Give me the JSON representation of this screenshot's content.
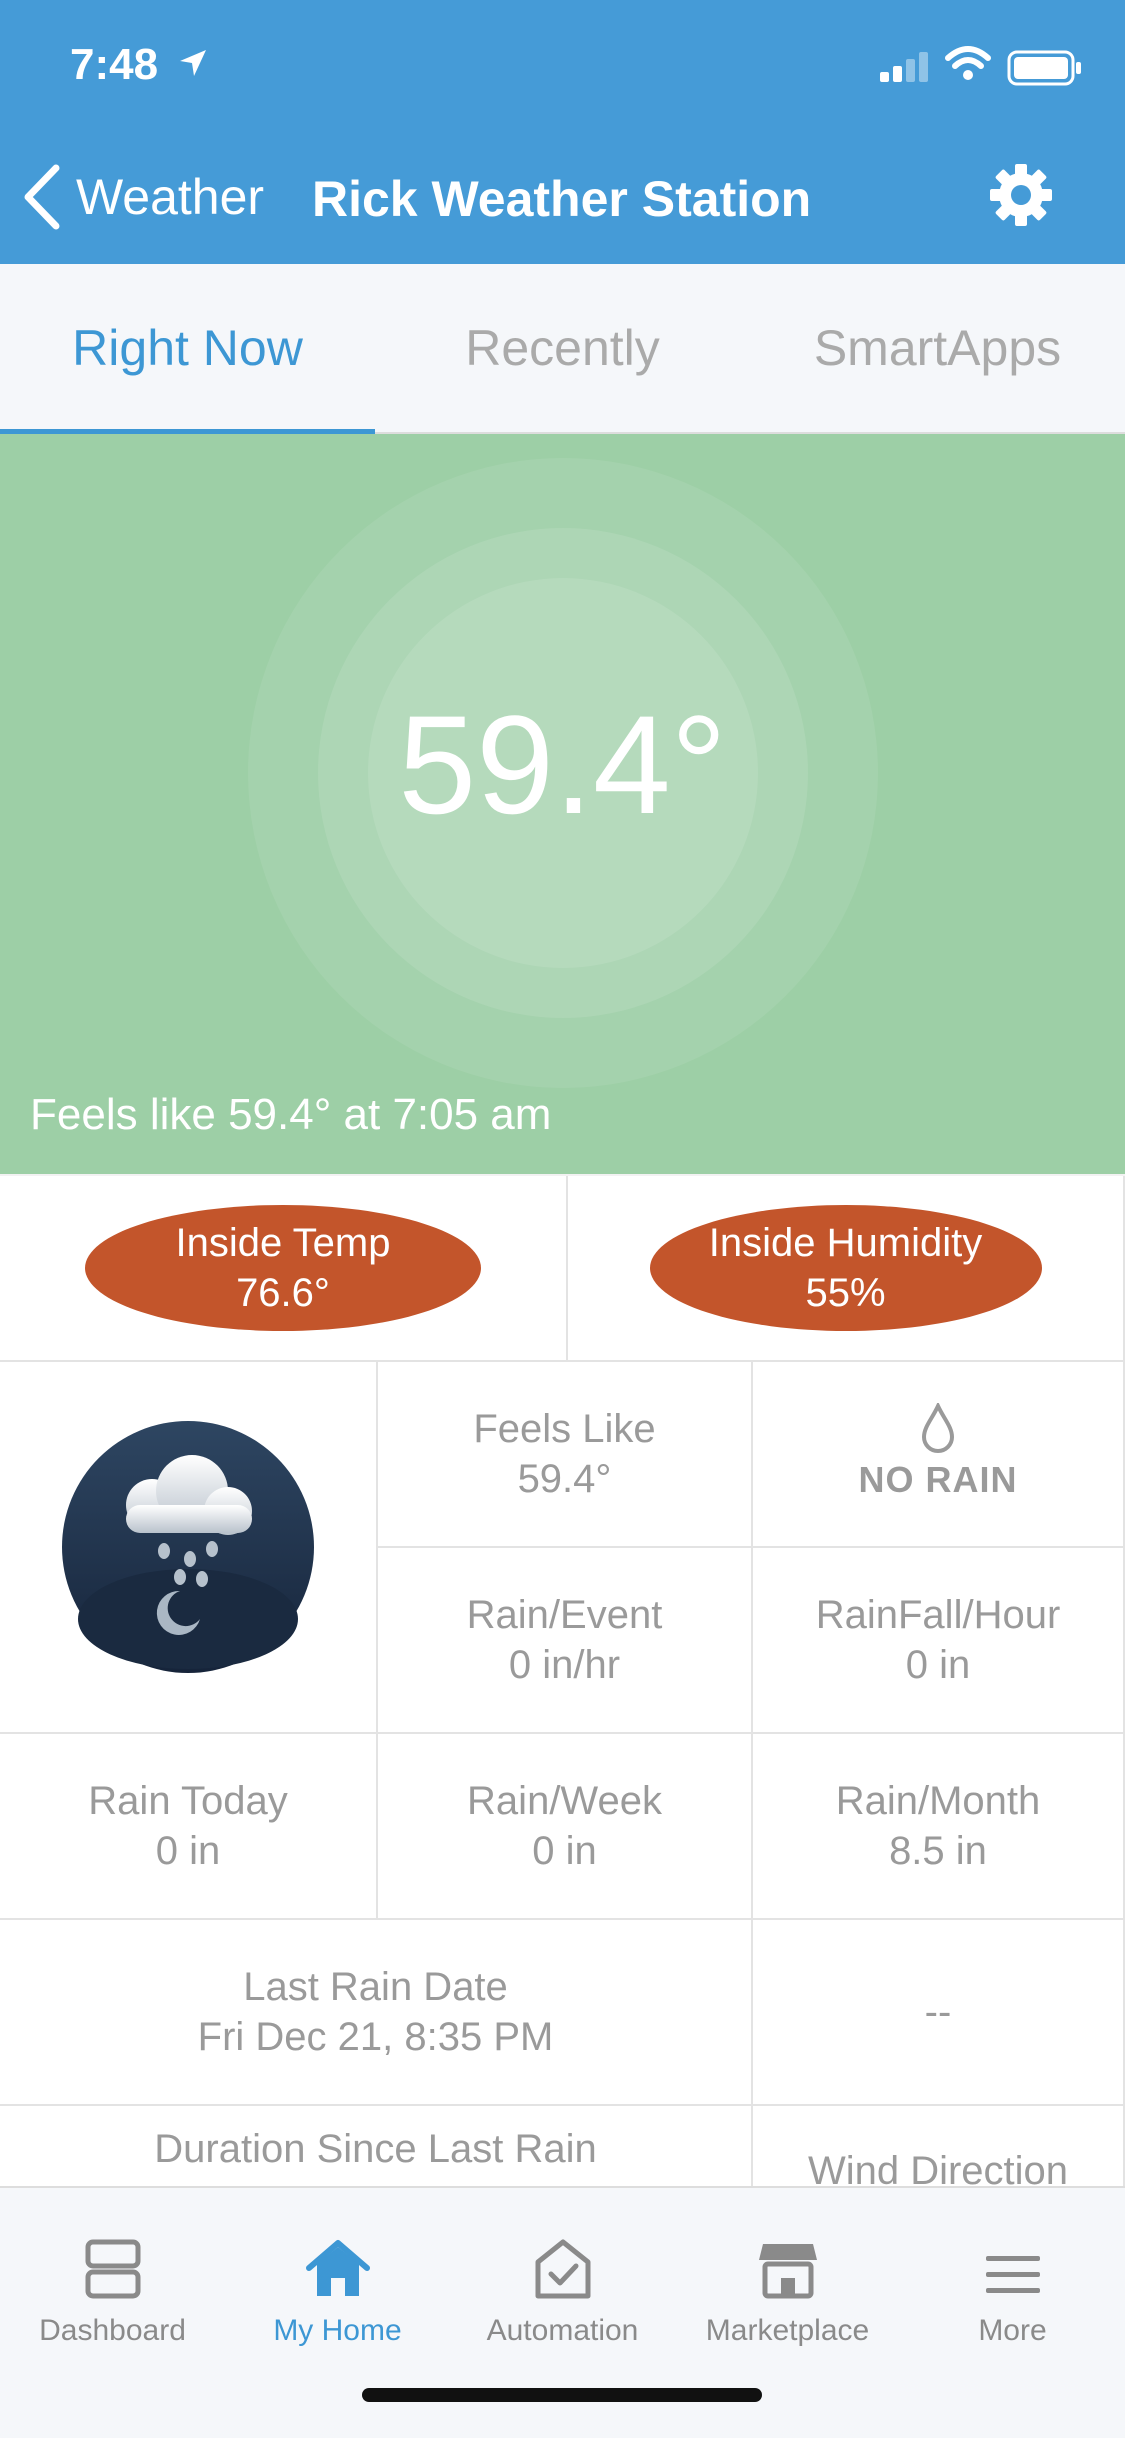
{
  "status_bar": {
    "time": "7:48"
  },
  "nav": {
    "back_label": "Weather",
    "title": "Rick Weather Station"
  },
  "tabs": [
    {
      "label": "Right Now",
      "active": true
    },
    {
      "label": "Recently",
      "active": false
    },
    {
      "label": "SmartApps",
      "active": false
    }
  ],
  "hero": {
    "temperature": "59.4°",
    "feels_like": "Feels like 59.4° at 7:05 am",
    "color": "#9dcfa6"
  },
  "inside": {
    "temp_label": "Inside Temp",
    "temp_value": "76.6°",
    "humidity_label": "Inside Humidity",
    "humidity_value": "55%",
    "pill_color": "#c3552b"
  },
  "tiles": {
    "weather_icon": "cloud-rain-moon-icon",
    "feels_like_label": "Feels Like",
    "feels_like_value": "59.4°",
    "no_rain_label": "NO RAIN",
    "rain_event_label": "Rain/Event",
    "rain_event_value": "0 in/hr",
    "rainfall_hour_label": "RainFall/Hour",
    "rainfall_hour_value": "0 in",
    "rain_today_label": "Rain Today",
    "rain_today_value": "0 in",
    "rain_week_label": "Rain/Week",
    "rain_week_value": "0 in",
    "rain_month_label": "Rain/Month",
    "rain_month_value": "8.5 in",
    "last_rain_label": "Last Rain Date",
    "last_rain_value": "Fri Dec 21, 8:35 PM",
    "placeholder_value": "--",
    "duration_label": "Duration Since Last Rain",
    "wind_direction_label": "Wind Direction"
  },
  "bottom_nav": [
    {
      "label": "Dashboard",
      "icon": "dashboard-icon",
      "active": false
    },
    {
      "label": "My Home",
      "icon": "home-icon",
      "active": true
    },
    {
      "label": "Automation",
      "icon": "automation-icon",
      "active": false
    },
    {
      "label": "Marketplace",
      "icon": "marketplace-icon",
      "active": false
    },
    {
      "label": "More",
      "icon": "menu-icon",
      "active": false
    }
  ],
  "colors": {
    "accent": "#459bd7",
    "active_tab": "#3d97d4"
  }
}
